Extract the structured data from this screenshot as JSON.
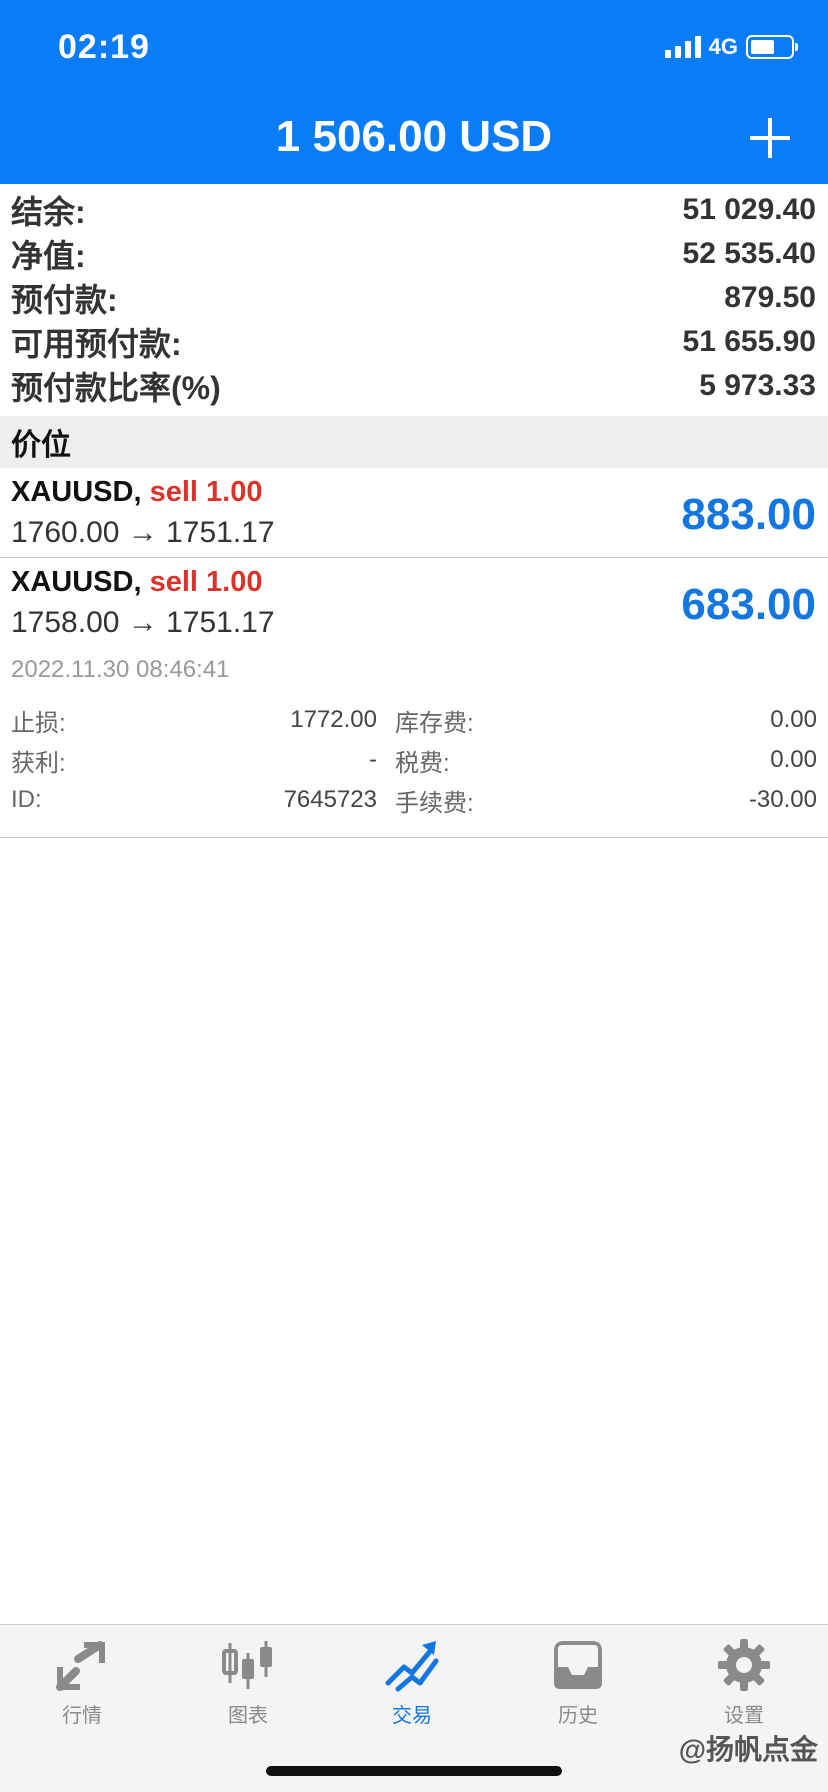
{
  "status_bar": {
    "time": "02:19",
    "network": "4G"
  },
  "header": {
    "title": "1 506.00 USD"
  },
  "summary": [
    {
      "label": "结余:",
      "value": "51 029.40"
    },
    {
      "label": "净值:",
      "value": "52 535.40"
    },
    {
      "label": "预付款:",
      "value": "879.50"
    },
    {
      "label": "可用预付款:",
      "value": "51 655.90"
    },
    {
      "label": "预付款比率(%)",
      "value": "5 973.33"
    }
  ],
  "section": {
    "title": "价位"
  },
  "positions": [
    {
      "symbol": "XAUUSD,",
      "type": "sell 1.00",
      "prices": "1760.00 → 1751.17",
      "profit": "883.00"
    },
    {
      "symbol": "XAUUSD,",
      "type": "sell 1.00",
      "prices": "1758.00 → 1751.17",
      "profit": "683.00",
      "time": "2022.11.30 08:46:41",
      "details": [
        {
          "label1": "止损:",
          "value1": "1772.00",
          "label2": "库存费:",
          "value2": "0.00"
        },
        {
          "label1": "获利:",
          "value1": "-",
          "label2": "税费:",
          "value2": "0.00"
        },
        {
          "label1": "ID:",
          "value1": "7645723",
          "label2": "手续费:",
          "value2": "-30.00"
        }
      ]
    }
  ],
  "tabbar": [
    {
      "label": "行情",
      "icon": "quotes-icon",
      "active": false
    },
    {
      "label": "图表",
      "icon": "chart-candles-icon",
      "active": false
    },
    {
      "label": "交易",
      "icon": "trade-icon",
      "active": true
    },
    {
      "label": "历史",
      "icon": "history-inbox-icon",
      "active": false
    },
    {
      "label": "设置",
      "icon": "settings-gear-icon",
      "active": false
    }
  ],
  "watermark": "@扬帆点金",
  "colors": {
    "header_bg": "#0a7cf7",
    "sell": "#d8342b",
    "profit": "#1477e0",
    "active_tab": "#1477e0"
  }
}
